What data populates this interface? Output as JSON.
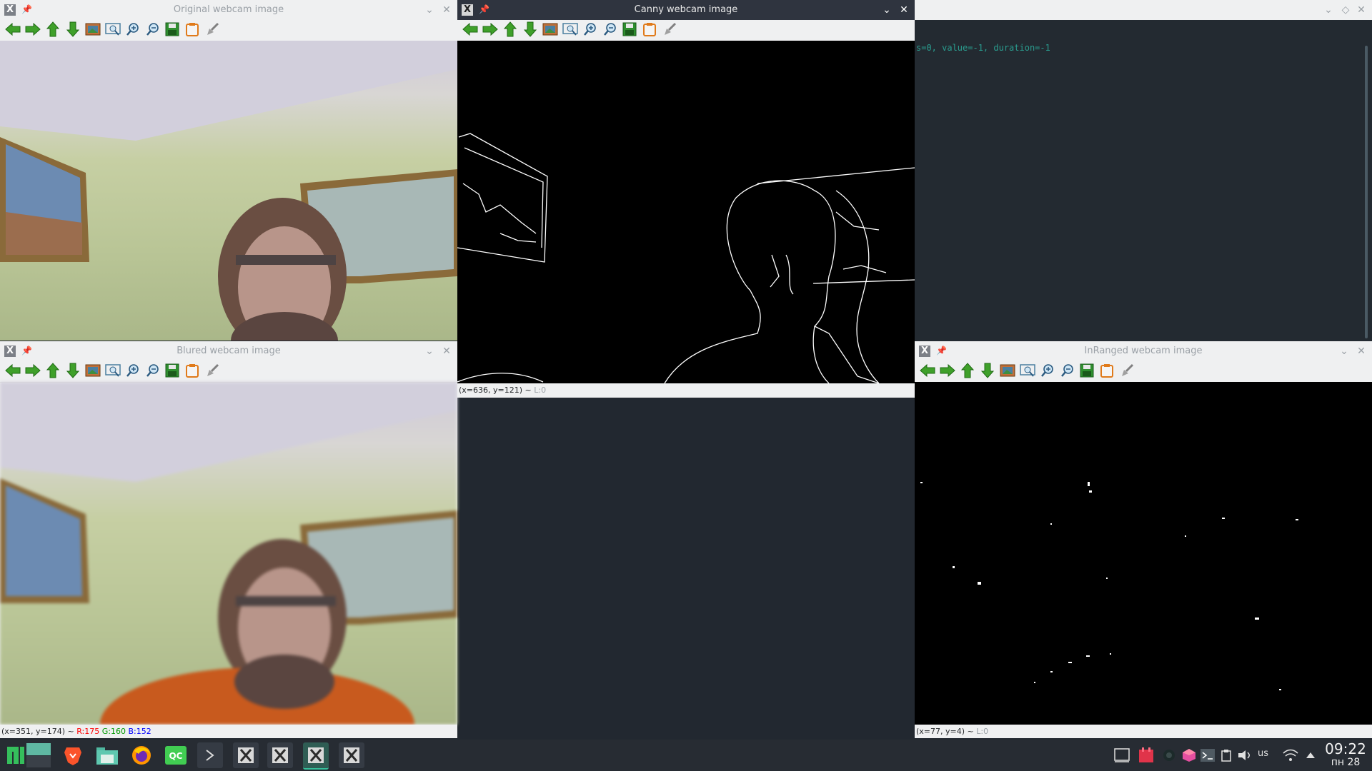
{
  "windows": {
    "original": {
      "title": "Original webcam image"
    },
    "canny": {
      "title": "Canny webcam image",
      "status_coords": "(x=636, y=121) ~ ",
      "status_level": "L:0"
    },
    "blured": {
      "title": "Blured webcam image",
      "status_coords": "(x=351, y=174) ~ ",
      "status_r": "R:175",
      "status_g": "G:160",
      "status_b": "B:152"
    },
    "inranged": {
      "title": "InRanged webcam image",
      "status_coords": "(x=77, y=4) ~ ",
      "status_level": "L:0"
    },
    "terminal": {
      "text": "s=0, value=-1, duration=-1"
    }
  },
  "toolbar_icons": [
    "arrow-left-icon",
    "arrow-right-icon",
    "arrow-up-icon",
    "arrow-down-icon",
    "image-icon",
    "zoom-fit-icon",
    "zoom-in-icon",
    "zoom-out-icon",
    "save-icon",
    "copy-icon",
    "brush-icon"
  ],
  "taskbar": {
    "apps": [
      "menu",
      "workspace",
      "brave",
      "files",
      "firefox",
      "qtcreator",
      "terminal",
      "x-window",
      "x-window",
      "x-window",
      "x-window"
    ],
    "tray": {
      "keyboard_layout": "us",
      "time": "09:22",
      "date": "пн 28"
    }
  },
  "colors": {
    "titlebar_active": "#2f343f",
    "titlebar_inactive": "#eff0f1",
    "taskbar": "#272c33",
    "terminal_bg": "#232a31",
    "terminal_text": "#2a9d8f"
  }
}
